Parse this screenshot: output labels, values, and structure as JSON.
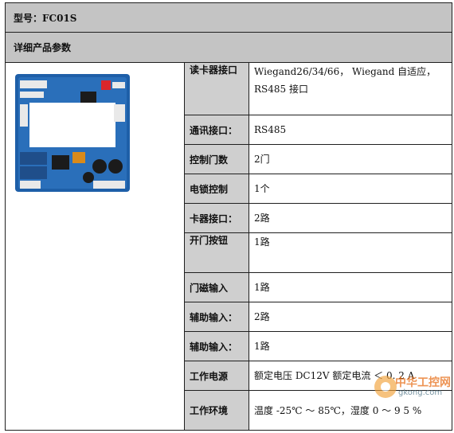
{
  "header": {
    "model_label": "型号：FC01S"
  },
  "section": {
    "title": "详细产品参数"
  },
  "image": {
    "alt": "controller-board"
  },
  "specs": [
    {
      "label": "读卡器接口",
      "value": "Wiegand26/34/66， Wiegand 自适应，RS485 接口"
    },
    {
      "label": "通讯接口：",
      "value": "RS485"
    },
    {
      "label": "控制门数",
      "value": "2门"
    },
    {
      "label": "电锁控制",
      "value": "1个"
    },
    {
      "label": "卡器接口：",
      "value": "2路"
    },
    {
      "label": "开门按钮",
      "value": "1路"
    },
    {
      "label": "门磁输入",
      "value": "1路"
    },
    {
      "label": "辅助输入：",
      "value": "2路"
    },
    {
      "label": "辅助输入：",
      "value": "1路"
    },
    {
      "label": "工作电源",
      "value": "额定电压 DC12V 额定电流 ＜ 0. 2 A"
    },
    {
      "label": "工作环境",
      "value": "温度 -25℃ ～ 85℃，湿度 0 ～ 9 5 %"
    }
  ],
  "watermark": {
    "brand": "中华工控网",
    "domain": "gkong.com"
  },
  "colors": {
    "header_bg": "#c4c4c4",
    "label_bg": "#cfcfcf",
    "pcb_blue": "#1e5fa8"
  }
}
